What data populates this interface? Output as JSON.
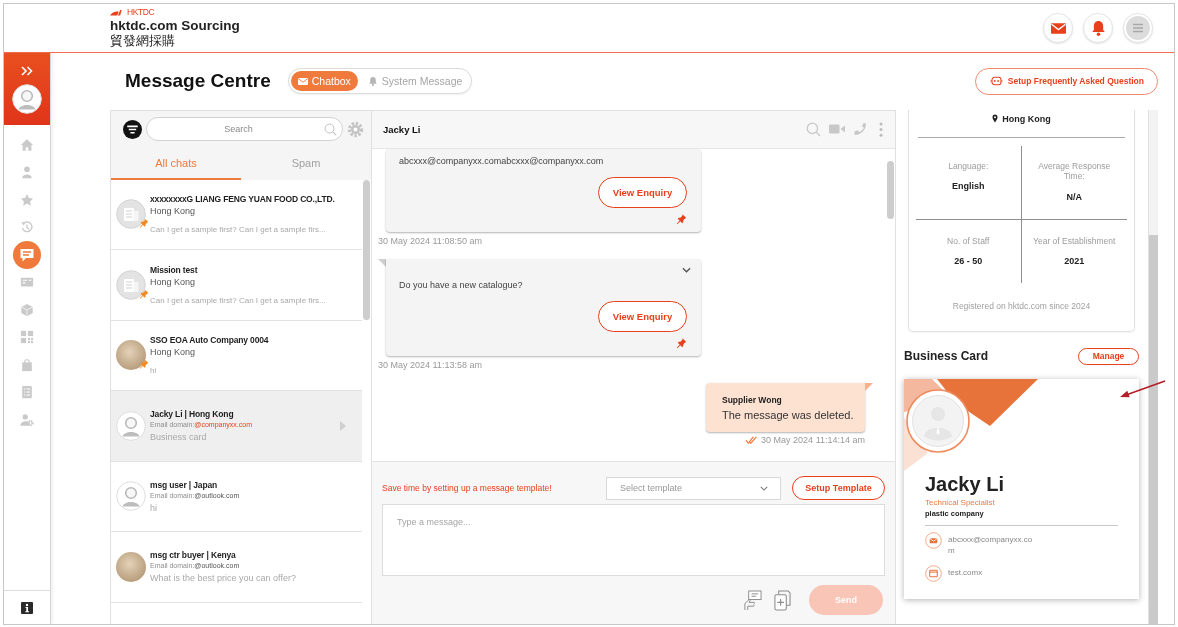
{
  "header": {
    "logo_mark": "HKTDC",
    "title": "hktdc.com Sourcing",
    "subtitle": "貿發網採購"
  },
  "sidebar": {
    "items": [
      {
        "kind": "home",
        "selected": false
      },
      {
        "kind": "person",
        "selected": false
      },
      {
        "kind": "star",
        "selected": false
      },
      {
        "kind": "history",
        "selected": false
      },
      {
        "kind": "chat",
        "selected": true
      },
      {
        "kind": "card",
        "selected": false
      },
      {
        "kind": "cube",
        "selected": false
      },
      {
        "kind": "grid",
        "selected": false
      },
      {
        "kind": "bag",
        "selected": false
      },
      {
        "kind": "checklist",
        "selected": false
      },
      {
        "kind": "user-gear",
        "selected": false
      }
    ]
  },
  "page": {
    "title": "Message Centre",
    "modes": [
      {
        "label": "Chatbox",
        "kind": "mail",
        "selected": true
      },
      {
        "label": "System Message",
        "kind": "bell",
        "selected": false
      }
    ],
    "faq_button": "Setup Frequently Asked Question"
  },
  "chat_list": {
    "search": {
      "placeholder": "Search"
    },
    "tabs": [
      {
        "label": "All chats",
        "selected": true
      },
      {
        "label": "Spam",
        "selected": false
      }
    ],
    "chats": [
      {
        "kind": "company",
        "avatar": {
          "kind": "building"
        },
        "pinned": true,
        "selected": false,
        "name": "xxxxxxxxG LIANG FENG YUAN FOOD CO.,LTD.",
        "location": "Hong Kong",
        "preview": "Can I get a sample first? Can I get a sample firs..."
      },
      {
        "kind": "company",
        "avatar": {
          "kind": "building"
        },
        "pinned": true,
        "selected": false,
        "name": "Mission test",
        "location": "Hong Kong",
        "preview": "Can I get a sample first? Can I get a sample firs..."
      },
      {
        "kind": "company",
        "avatar": {
          "kind": "photo"
        },
        "pinned": true,
        "selected": false,
        "name": "SSO EOA Auto Company 0004",
        "location": "Hong Kong",
        "preview": "hi"
      },
      {
        "kind": "contact",
        "avatar": {
          "kind": "person"
        },
        "pinned": false,
        "selected": true,
        "title": "Jacky Li | Hong Kong",
        "email_label": "Email domain:",
        "email_domain": "@companyxx.com",
        "highlighted": true,
        "preview": "Business card"
      },
      {
        "kind": "contact",
        "avatar": {
          "kind": "person"
        },
        "pinned": false,
        "selected": false,
        "title": "msg user | Japan",
        "email_label": "Email domain:",
        "email_domain": "@outlook.com",
        "highlighted": false,
        "preview": "hi"
      },
      {
        "kind": "contact",
        "avatar": {
          "kind": "photo"
        },
        "pinned": false,
        "selected": false,
        "title": "msg ctr buyer | Kenya",
        "email_label": "Email domain:",
        "email_domain": "@outlook.com",
        "highlighted": false,
        "preview": "What is the best price you can offer?"
      }
    ]
  },
  "conversation": {
    "contact": "Jacky Li",
    "messages": [
      {
        "kind": "enquiry",
        "tail": false,
        "menu": false,
        "pinned": true,
        "text": "abcxxx@companyxx.comabcxxx@companyxx.com",
        "button": "View Enquiry",
        "time": "30 May 2024 11:08:50 am"
      },
      {
        "kind": "enquiry",
        "tail": true,
        "menu": true,
        "pinned": true,
        "text": "Do you have a new catalogue?",
        "button": "View Enquiry",
        "time": "30 May 2024 11:13:58 am"
      },
      {
        "kind": "sent",
        "tail": true,
        "read": true,
        "sender": "Supplier Wong",
        "text": "The message was deleted.",
        "time": "30 May 2024 11:14:14 am"
      }
    ]
  },
  "composer": {
    "hint": "Save time by setting up a message template!",
    "template_select": {
      "placeholder": "Select template"
    },
    "setup_button": "Setup Template",
    "message": {
      "placeholder": "Type a message..."
    },
    "send": {
      "label": "Send",
      "disabled": true
    }
  },
  "profile": {
    "location": "Hong Kong",
    "stats": [
      {
        "label": "Language:",
        "value": "English"
      },
      {
        "label": "Average Response Time:",
        "value": "N/A"
      },
      {
        "label": "No. of Staff",
        "value": "26 - 50"
      },
      {
        "label": "Year of Establishment",
        "value": "2021"
      }
    ],
    "registered": "Registered on hktdc.com since 2024"
  },
  "business_card": {
    "heading": "Business Card",
    "manage_button": "Manage",
    "name": "Jacky Li",
    "job_title": "Technical Specialist",
    "company": "plastic company",
    "contacts": [
      {
        "kind": "email",
        "text": "abcxxx@companyxx.com"
      },
      {
        "kind": "website",
        "text": "test.comx"
      }
    ]
  }
}
